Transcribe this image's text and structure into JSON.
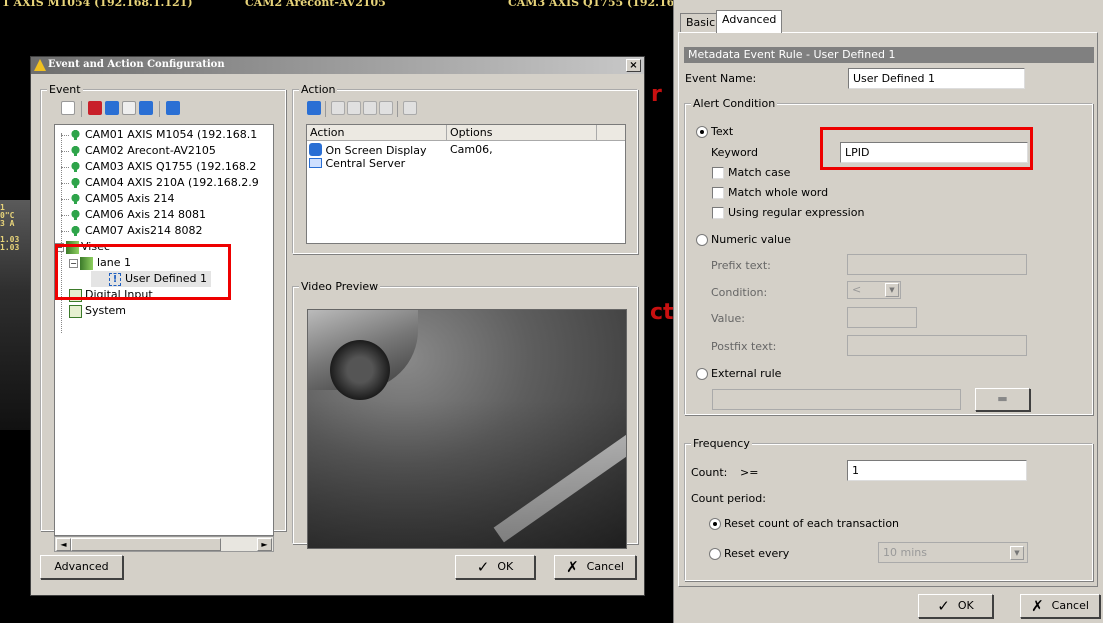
{
  "camera_header": {
    "cam1": "1 AXIS M1054 (192.168.1.121)",
    "cam2": "CAM2 Arecont-AV2105",
    "cam3": "CAM3 AXIS Q1755 (192.16"
  },
  "left_strip_text": [
    "1",
    "0\"C",
    "3 A",
    "1.03",
    "1.03"
  ],
  "dialog": {
    "title": "Event and Action Configuration",
    "close": "×",
    "event_group": "Event",
    "tree": [
      {
        "label": "CAM01 AXIS M1054 (192.168.1"
      },
      {
        "label": "CAM02 Arecont-AV2105"
      },
      {
        "label": "CAM03 AXIS Q1755 (192.168.2"
      },
      {
        "label": "CAM04 AXIS 210A (192.168.2.9"
      },
      {
        "label": "CAM05 Axis 214"
      },
      {
        "label": "CAM06 Axis 214 8081"
      },
      {
        "label": "CAM07 Axis214 8082"
      },
      {
        "label": "Visec"
      },
      {
        "label": "lane 1"
      },
      {
        "label": "User Defined 1"
      },
      {
        "label": "Digital Input"
      },
      {
        "label": "System"
      }
    ],
    "action_group": "Action",
    "action_table": {
      "headers": [
        "Action",
        "Options"
      ],
      "rows": [
        {
          "action": "On Screen Display",
          "options": "Cam06,"
        },
        {
          "action": "Central Server",
          "options": ""
        }
      ]
    },
    "video_group": "Video Preview",
    "advanced_button": "Advanced",
    "ok_button": "OK",
    "cancel_button": "Cancel",
    "scroll_left": "◄",
    "scroll_right": "►"
  },
  "right_panel": {
    "tabs": [
      "Basic",
      "Advanced"
    ],
    "active_tab": "Advanced",
    "section_title": "Metadata Event Rule - User Defined 1",
    "event_name_label": "Event Name:",
    "event_name_value": "User Defined 1",
    "alert_condition": "Alert Condition",
    "text_option": "Text",
    "keyword_label": "Keyword",
    "keyword_value": "LPID",
    "match_case": "Match case",
    "match_whole_word": "Match whole word",
    "using_regex": "Using regular expression",
    "numeric_option": "Numeric value",
    "prefix_label": "Prefix text:",
    "condition_label": "Condition:",
    "condition_value": "<",
    "value_label": "Value:",
    "postfix_label": "Postfix text:",
    "external_option": "External rule",
    "frequency_group": "Frequency",
    "count_label": "Count:",
    "count_operator": ">=",
    "count_value": "1",
    "count_period_label": "Count period:",
    "reset_each": "Reset count of each transaction",
    "reset_every": "Reset every",
    "reset_every_value": "10 mins",
    "ok_button": "OK",
    "cancel_button": "Cancel"
  },
  "colors": {
    "highlight_red": "#e00000",
    "dialog_bg": "#d4d0c8",
    "camera_icon": "#2ea44a"
  }
}
